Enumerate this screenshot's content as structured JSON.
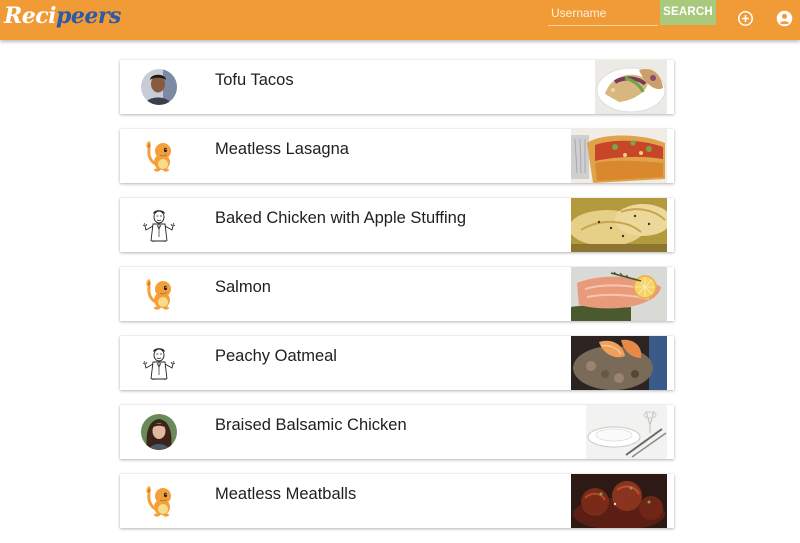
{
  "app": {
    "logo_part1": "Reci",
    "logo_part2": "peers"
  },
  "header": {
    "username_placeholder": "Username",
    "search_label": "SEARCH",
    "add_icon": "plus-circle-icon",
    "account_icon": "account-circle-icon"
  },
  "colors": {
    "topbar": "#f09b35",
    "search_button": "#a9c97d",
    "logo_accent": "#2a5aa8"
  },
  "recipes": [
    {
      "title": "Tofu Tacos",
      "avatar": "user-photo-man"
    },
    {
      "title": "Meatless Lasagna",
      "avatar": "charmander-avatar"
    },
    {
      "title": "Baked Chicken with Apple Stuffing",
      "avatar": "sketch-man-avatar"
    },
    {
      "title": "Salmon",
      "avatar": "charmander-avatar"
    },
    {
      "title": "Peachy Oatmeal",
      "avatar": "sketch-man-avatar"
    },
    {
      "title": "Braised Balsamic Chicken",
      "avatar": "user-photo-woman"
    },
    {
      "title": "Meatless Meatballs",
      "avatar": "charmander-avatar"
    }
  ]
}
